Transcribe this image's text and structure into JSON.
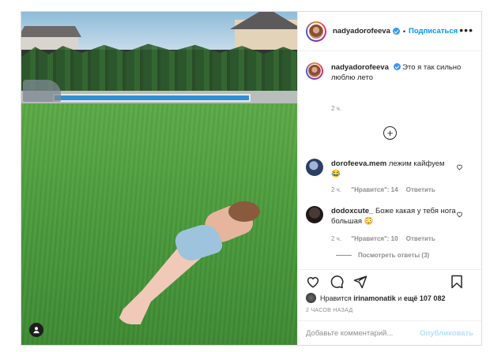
{
  "post": {
    "author": {
      "username": "nadyadorofeeva",
      "verified": true,
      "follow_label": "Подписаться",
      "more_label": "•••",
      "separator": "•"
    },
    "caption": {
      "username": "nadyadorofeeva",
      "text": "Это я так сильно люблю лето",
      "time": "2 ч."
    },
    "load_more_icon": "plus-circle-icon",
    "comments": [
      {
        "username": "dorofeeva.mem",
        "text": "лежим кайфуем",
        "emoji": "😂",
        "time": "2 ч.",
        "likes_label": "\"Нравится\": 14",
        "reply_label": "Ответить"
      },
      {
        "username": "dodoxcute_",
        "text": "Боже какая у тебя нога большая",
        "emoji": "😳",
        "time": "2 ч.",
        "likes_label": "\"Нравится\": 10",
        "reply_label": "Ответить"
      }
    ],
    "view_replies": "Посмотреть ответы (3)",
    "actions": [
      "heart-icon",
      "comment-icon",
      "share-icon",
      "bookmark-icon"
    ],
    "likes": {
      "prefix": "Нравится",
      "user": "irinamonatik",
      "middle": "и",
      "count": "ещё 107 082"
    },
    "timestamp": "2 ЧАСОВ НАЗАД",
    "add_comment": {
      "placeholder": "Добавьте комментарий...",
      "publish_label": "Опубликовать"
    }
  },
  "colors": {
    "accent": "#0095f6",
    "publish_disabled": "#b2dffc",
    "muted": "#8e8e8e",
    "text": "#262626",
    "border": "#dbdbdb"
  }
}
